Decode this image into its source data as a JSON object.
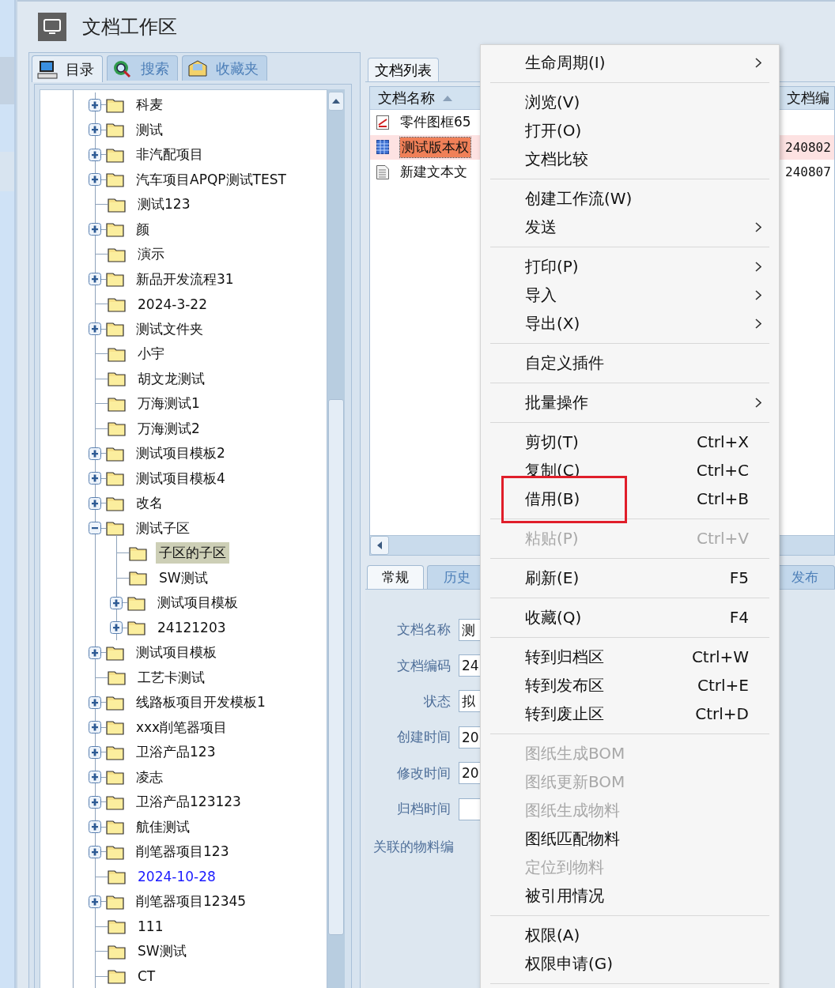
{
  "window": {
    "title": "文档工作区"
  },
  "nav_tabs": [
    {
      "label": "目录",
      "selected": true
    },
    {
      "label": "搜索",
      "selected": false
    },
    {
      "label": "收藏夹",
      "selected": false
    }
  ],
  "tree": {
    "items": [
      {
        "label": "科麦",
        "expandable": true,
        "expanded": false,
        "selected": false
      },
      {
        "label": "测试",
        "expandable": true,
        "expanded": false,
        "selected": false
      },
      {
        "label": "非汽配项目",
        "expandable": true,
        "expanded": false,
        "selected": false
      },
      {
        "label": "汽车项目APQP测试TEST",
        "expandable": true,
        "expanded": false,
        "selected": false
      },
      {
        "label": "测试123",
        "expandable": false,
        "selected": false
      },
      {
        "label": "颜",
        "expandable": true,
        "expanded": false,
        "selected": false
      },
      {
        "label": "演示",
        "expandable": false,
        "selected": false
      },
      {
        "label": "新品开发流程31",
        "expandable": true,
        "expanded": false,
        "selected": false
      },
      {
        "label": "2024-3-22",
        "expandable": false,
        "selected": false
      },
      {
        "label": "测试文件夹",
        "expandable": true,
        "expanded": false,
        "selected": false
      },
      {
        "label": "小宇",
        "expandable": false,
        "selected": false
      },
      {
        "label": "胡文龙测试",
        "expandable": false,
        "selected": false
      },
      {
        "label": "万海测试1",
        "expandable": false,
        "selected": false
      },
      {
        "label": "万海测试2",
        "expandable": false,
        "selected": false
      },
      {
        "label": "测试项目模板2",
        "expandable": true,
        "expanded": false,
        "selected": false
      },
      {
        "label": "测试项目模板4",
        "expandable": true,
        "expanded": false,
        "selected": false
      },
      {
        "label": "改名",
        "expandable": true,
        "expanded": false,
        "selected": false
      },
      {
        "label": "测试子区",
        "expandable": true,
        "expanded": true,
        "selected": false,
        "children": [
          {
            "label": "子区的子区",
            "expandable": false,
            "selected": true
          },
          {
            "label": "SW测试",
            "expandable": false,
            "selected": false
          },
          {
            "label": "测试项目模板",
            "expandable": true,
            "expanded": false,
            "selected": false
          },
          {
            "label": "24121203",
            "expandable": true,
            "expanded": false,
            "selected": false
          }
        ]
      },
      {
        "label": "测试项目模板",
        "expandable": true,
        "expanded": false,
        "selected": false
      },
      {
        "label": "工艺卡测试",
        "expandable": false,
        "selected": false
      },
      {
        "label": "线路板项目开发模板1",
        "expandable": true,
        "expanded": false,
        "selected": false
      },
      {
        "label": "xxx削笔器项目",
        "expandable": true,
        "expanded": false,
        "selected": false
      },
      {
        "label": "卫浴产品123",
        "expandable": true,
        "expanded": false,
        "selected": false
      },
      {
        "label": "凌志",
        "expandable": true,
        "expanded": false,
        "selected": false
      },
      {
        "label": "卫浴产品123123",
        "expandable": true,
        "expanded": false,
        "selected": false
      },
      {
        "label": "航佳测试",
        "expandable": true,
        "expanded": false,
        "selected": false
      },
      {
        "label": "削笔器项目123",
        "expandable": true,
        "expanded": false,
        "selected": false
      },
      {
        "label": "2024-10-28",
        "expandable": false,
        "selected": false,
        "color": "#1a1aff"
      },
      {
        "label": "削笔器项目12345",
        "expandable": true,
        "expanded": false,
        "selected": false
      },
      {
        "label": "111",
        "expandable": false,
        "selected": false
      },
      {
        "label": "SW测试",
        "expandable": false,
        "selected": false
      },
      {
        "label": "CT",
        "expandable": false,
        "selected": false
      }
    ]
  },
  "doc_list": {
    "tab": "文档列表",
    "columns": [
      "文档名称",
      "文档编"
    ],
    "rows": [
      {
        "kind": "drawing",
        "name": "零件图框65",
        "selected": false
      },
      {
        "kind": "grid",
        "name": "测试版本权",
        "code": "240802",
        "selected": true
      },
      {
        "kind": "text",
        "name": "新建文本文",
        "code": "240807",
        "selected": false
      }
    ]
  },
  "detail_tabs": [
    {
      "label": "常规",
      "selected": true
    },
    {
      "label": "历史",
      "selected": false
    },
    {
      "label": "发布",
      "selected": false
    }
  ],
  "detail_fields": [
    {
      "label": "文档名称",
      "value": "测"
    },
    {
      "label": "文档编码",
      "value": "24"
    },
    {
      "label": "状态",
      "value": "拟"
    },
    {
      "label": "创建时间",
      "value": "20"
    },
    {
      "label": "修改时间",
      "value": "20"
    },
    {
      "label": "归档时间"
    }
  ],
  "related_label": "关联的物料编",
  "context_menu": {
    "items": [
      {
        "kind": "item",
        "label": "生命周期(I)",
        "submenu": true,
        "disabled": false
      },
      {
        "kind": "separator"
      },
      {
        "kind": "item",
        "label": "浏览(V)",
        "submenu": false,
        "disabled": false
      },
      {
        "kind": "item",
        "label": "打开(O)",
        "submenu": false,
        "disabled": false
      },
      {
        "kind": "item",
        "label": "文档比较",
        "submenu": false,
        "disabled": false
      },
      {
        "kind": "separator"
      },
      {
        "kind": "item",
        "label": "创建工作流(W)",
        "submenu": false,
        "disabled": false
      },
      {
        "kind": "item",
        "label": "发送",
        "submenu": true,
        "disabled": false
      },
      {
        "kind": "separator"
      },
      {
        "kind": "item",
        "label": "打印(P)",
        "submenu": true,
        "disabled": false
      },
      {
        "kind": "item",
        "label": "导入",
        "submenu": true,
        "disabled": false
      },
      {
        "kind": "item",
        "label": "导出(X)",
        "submenu": true,
        "disabled": false
      },
      {
        "kind": "separator"
      },
      {
        "kind": "item",
        "label": "自定义插件",
        "submenu": false,
        "disabled": false
      },
      {
        "kind": "separator"
      },
      {
        "kind": "item",
        "label": "批量操作",
        "submenu": true,
        "disabled": false
      },
      {
        "kind": "separator"
      },
      {
        "kind": "item",
        "label": "剪切(T)",
        "shortcut": "Ctrl+X",
        "submenu": false,
        "disabled": false
      },
      {
        "kind": "item",
        "label": "复制(C)",
        "shortcut": "Ctrl+C",
        "submenu": false,
        "disabled": false
      },
      {
        "kind": "item",
        "label": "借用(B)",
        "shortcut": "Ctrl+B",
        "submenu": false,
        "disabled": false,
        "annotated": true
      },
      {
        "kind": "separator"
      },
      {
        "kind": "item",
        "label": "粘贴(P)",
        "shortcut": "Ctrl+V",
        "submenu": false,
        "disabled": true
      },
      {
        "kind": "separator"
      },
      {
        "kind": "item",
        "label": "刷新(E)",
        "shortcut": "F5",
        "submenu": false,
        "disabled": false
      },
      {
        "kind": "separator"
      },
      {
        "kind": "item",
        "label": "收藏(Q)",
        "shortcut": "F4",
        "submenu": false,
        "disabled": false
      },
      {
        "kind": "separator"
      },
      {
        "kind": "item",
        "label": "转到归档区",
        "shortcut": "Ctrl+W",
        "submenu": false,
        "disabled": false
      },
      {
        "kind": "item",
        "label": "转到发布区",
        "shortcut": "Ctrl+E",
        "submenu": false,
        "disabled": false
      },
      {
        "kind": "item",
        "label": "转到废止区",
        "shortcut": "Ctrl+D",
        "submenu": false,
        "disabled": false
      },
      {
        "kind": "separator"
      },
      {
        "kind": "item",
        "label": "图纸生成BOM",
        "submenu": false,
        "disabled": true
      },
      {
        "kind": "item",
        "label": "图纸更新BOM",
        "submenu": false,
        "disabled": true
      },
      {
        "kind": "item",
        "label": "图纸生成物料",
        "submenu": false,
        "disabled": true
      },
      {
        "kind": "item",
        "label": "图纸匹配物料",
        "submenu": false,
        "disabled": false
      },
      {
        "kind": "item",
        "label": "定位到物料",
        "submenu": false,
        "disabled": true
      },
      {
        "kind": "item",
        "label": "被引用情况",
        "submenu": false,
        "disabled": false
      },
      {
        "kind": "separator"
      },
      {
        "kind": "item",
        "label": "权限(A)",
        "submenu": false,
        "disabled": false
      },
      {
        "kind": "item",
        "label": "权限申请(G)",
        "submenu": false,
        "disabled": false
      },
      {
        "kind": "separator"
      }
    ]
  }
}
